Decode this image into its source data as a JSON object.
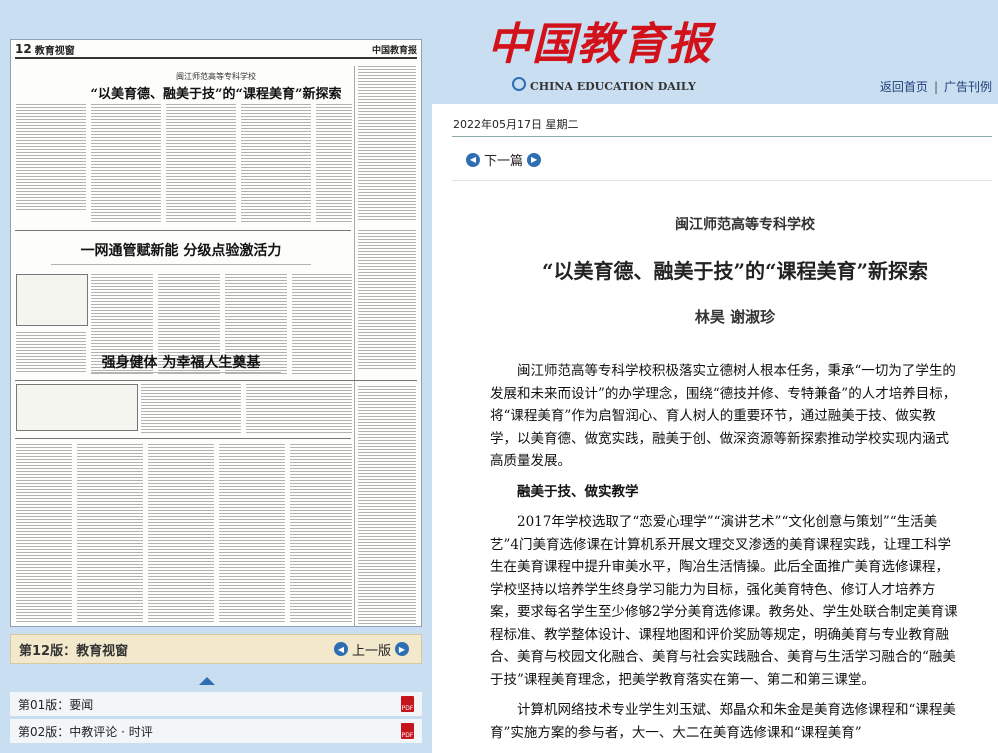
{
  "left": {
    "paper": {
      "page_no": "12",
      "section": "教育视窗",
      "masthead": "中国教育报",
      "kicker": "闽江师范高等专科学校",
      "headline1": "“以美育德、融美于技”的“课程美育”新探索",
      "headline2": "一网通管赋新能 分级点验激活力",
      "headline3": "强身健体 为幸福人生奠基"
    },
    "edition_bar": {
      "name": "第12版：教育视窗",
      "prev": "上一版"
    },
    "pages": [
      {
        "label": "第01版：要闻"
      },
      {
        "label": "第02版：中教评论 · 时评"
      }
    ]
  },
  "right": {
    "logo_cn": "中国教育报",
    "logo_en": "CHINA EDUCATION DAILY",
    "nav": {
      "home": "返回首页",
      "ads": "广告刊例"
    },
    "date": "2022年05月17日  星期二",
    "next": "下一篇",
    "article": {
      "kicker": "闽江师范高等专科学校",
      "title": "“以美育德、融美于技”的“课程美育”新探索",
      "byline": "林昊  谢淑珍",
      "p1": "闽江师范高等专科学校积极落实立德树人根本任务，秉承“一切为了学生的发展和未来而设计”的办学理念，围绕“德技并修、专特兼备”的人才培养目标，将“课程美育”作为启智润心、育人树人的重要环节，通过融美于技、做实教学，以美育德、做宽实践，融美于创、做深资源等新探索推动学校实现内涵式高质量发展。",
      "h1": "融美于技、做实教学",
      "p2": "2017年学校选取了“恋爱心理学”“演讲艺术”“文化创意与策划”“生活美艺”4门美育选修课在计算机系开展文理交叉渗透的美育课程实践，让理工科学生在美育课程中提升审美水平，陶冶生活情操。此后全面推广美育选修课程，学校坚持以培养学生终身学习能力为目标，强化美育特色、修订人才培养方案，要求每名学生至少修够2学分美育选修课。教务处、学生处联合制定美育课程标准、教学整体设计、课程地图和评价奖励等规定，明确美育与专业教育融合、美育与校园文化融合、美育与社会实践融合、美育与生活学习融合的“融美于技”课程美育理念，把美学教育落实在第一、第二和第三课堂。",
      "p3": "计算机网络技术专业学生刘玉斌、郑晶众和朱金是美育选修课程和“课程美育”实施方案的参与者，大一、大二在美育选修课和“课程美育”"
    }
  }
}
